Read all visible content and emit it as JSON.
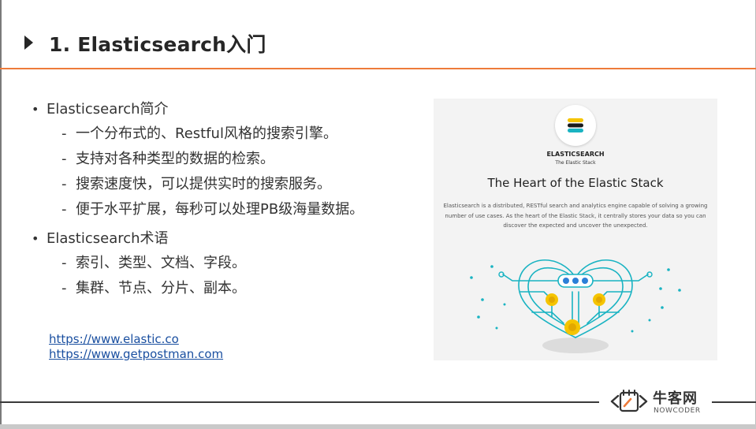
{
  "slide": {
    "title": "1. Elasticsearch入门",
    "accent_color": "#ee7b3a"
  },
  "bullets": [
    {
      "label": "Elasticsearch简介",
      "items": [
        "一个分布式的、Restful风格的搜索引擎。",
        "支持对各种类型的数据的检索。",
        "搜索速度快，可以提供实时的搜索服务。",
        "便于水平扩展，每秒可以处理PB级海量数据。"
      ]
    },
    {
      "label": "Elasticsearch术语",
      "items": [
        "索引、类型、文档、字段。",
        "集群、节点、分片、副本。"
      ]
    }
  ],
  "links": [
    "https://www.elastic.co",
    "https://www.getpostman.com"
  ],
  "elastic_card": {
    "brand": "ELASTICSEARCH",
    "sub": "The Elastic Stack",
    "heading": "The Heart of the Elastic Stack",
    "description": "Elasticsearch is a distributed, RESTful search and analytics engine capable of solving a growing number of use cases. As the heart of the Elastic Stack, it centrally stores your data so you can discover the expected and uncover the unexpected.",
    "colors": {
      "teal": "#19b3c2",
      "yellow": "#f5c400",
      "blue": "#2c7fd8"
    },
    "logo_icon": "elasticsearch-logo-icon",
    "illustration_icon": "heart-circuit-illustration"
  },
  "footer": {
    "logo_icon": "nowcoder-logo-icon",
    "logo_cn": "牛客网",
    "logo_en": "NOWCODER"
  }
}
